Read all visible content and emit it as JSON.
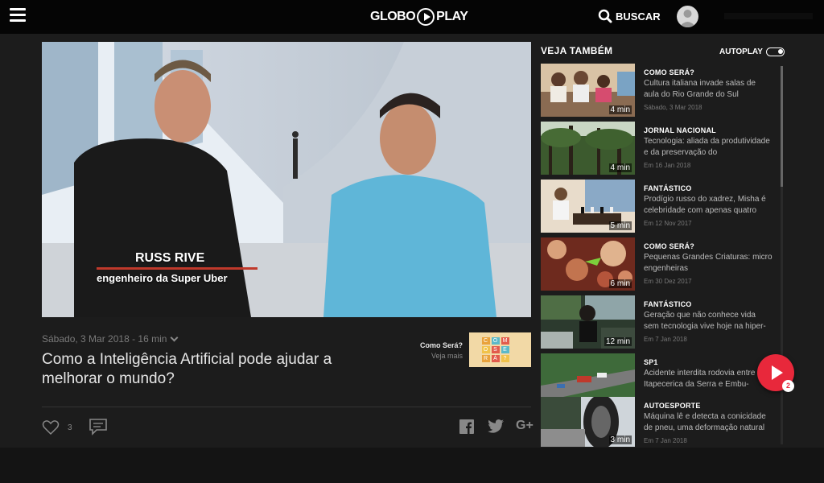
{
  "header": {
    "logo_globo": "GLOBO",
    "logo_play": "PLAY",
    "search_label": "BUSCAR"
  },
  "player": {
    "overlay_name": "RUSS RIVE",
    "overlay_role": "engenheiro da Super Uber"
  },
  "video": {
    "meta": "Sábado, 3 Mar 2018 - 16 min",
    "title": "Como a Inteligência Artificial pode ajudar a melhorar o mundo?",
    "program_name": "Como Será?",
    "program_more": "Veja mais",
    "program_thumb_letters": [
      "C",
      "O",
      "M",
      "",
      "O",
      "S",
      "E",
      "",
      "R",
      "Á",
      "?",
      ""
    ],
    "like_count": "3"
  },
  "sidebar": {
    "header": "VEJA TAMBÉM",
    "autoplay_label": "AUTOPLAY",
    "items": [
      {
        "program": "COMO SERÁ?",
        "title": "Cultura italiana invade salas de aula do Rio Grande do Sul",
        "date": "Sábado, 3 Mar 2018",
        "duration": "4 min"
      },
      {
        "program": "JORNAL NACIONAL",
        "title": "Tecnologia: aliada da produtividade e da preservação do",
        "date": "Em 16 Jan 2018",
        "duration": "4 min"
      },
      {
        "program": "FANTÁSTICO",
        "title": "Prodígio russo do xadrez, Misha é celebridade com apenas quatro",
        "date": "Em 12 Nov 2017",
        "duration": "5 min"
      },
      {
        "program": "COMO SERÁ?",
        "title": "Pequenas Grandes Criaturas: micro engenheiras",
        "date": "Em 30 Dez 2017",
        "duration": "6 min"
      },
      {
        "program": "FANTÁSTICO",
        "title": "Geração que não conhece vida sem tecnologia vive hoje na hiper-",
        "date": "Em 7 Jan 2018",
        "duration": "12 min"
      },
      {
        "program": "SP1",
        "title": "Acidente interdita rodovia entre Itapecerica da Serra e Embu-",
        "date": "",
        "duration": ""
      },
      {
        "program": "AUTOESPORTE",
        "title": "Máquina lê e detecta a conicidade de pneu, uma deformação natural",
        "date": "Em 7 Jan 2018",
        "duration": "3 min"
      }
    ]
  },
  "queue": {
    "count": "2"
  },
  "colors": {
    "accent": "#e8283b",
    "background": "#1c1c1c",
    "topbar": "#050505"
  }
}
